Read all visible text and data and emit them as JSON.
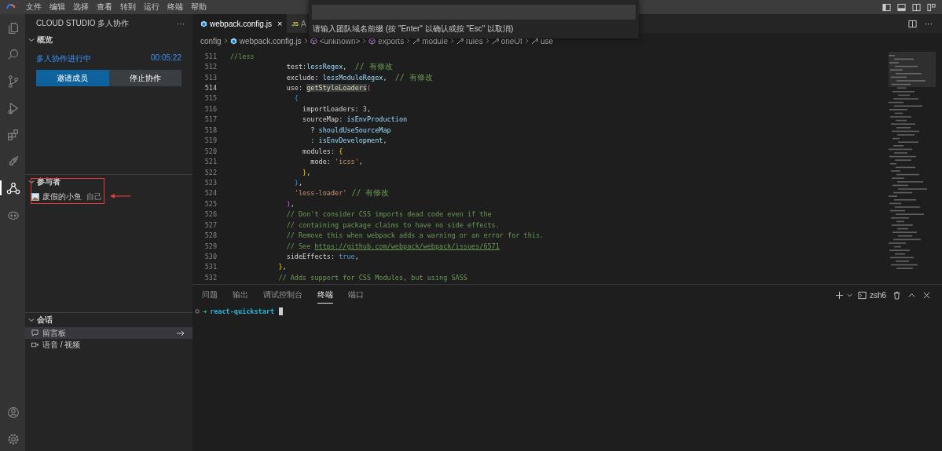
{
  "menu": {
    "items": [
      "文件",
      "编辑",
      "选择",
      "查看",
      "转到",
      "运行",
      "终端",
      "帮助"
    ]
  },
  "activity_bar": {
    "items": [
      {
        "selected": false
      },
      {
        "selected": false
      },
      {
        "selected": false
      },
      {
        "selected": false
      },
      {
        "selected": false
      },
      {
        "selected": false
      },
      {
        "selected": true
      },
      {
        "selected": false
      }
    ]
  },
  "sidebar": {
    "title": "CLOUD STUDIO 多人协作",
    "more": "···",
    "overview": {
      "title": "概览",
      "expanded": true,
      "status": "多人协作进行中",
      "timer": "00:05:22",
      "buttons": [
        {
          "label": "邀请成员",
          "primary": true
        },
        {
          "label": "停止协作",
          "primary": false
        }
      ]
    },
    "participants": {
      "title": "参与者",
      "expanded": true,
      "items": [
        {
          "name": "废假的小鱼",
          "tag": "自己",
          "annotated": true
        }
      ]
    },
    "sessions": {
      "title": "会话",
      "expanded": true,
      "items": [
        {
          "label": "留言板",
          "hovered": true
        },
        {
          "label": "语音 / 视频",
          "hovered": false
        }
      ]
    }
  },
  "quick_input": {
    "hint": "请输入团队域名前缀 (按 \"Enter\" 以确认或按 \"Esc\" 以取消)"
  },
  "tabs": [
    {
      "label": "webpack.config.js",
      "kind": "webpack",
      "close": "×",
      "selected": true
    },
    {
      "label": "A",
      "kind": "js",
      "badge": "JS",
      "selected": false
    }
  ],
  "editor_more": "···",
  "breadcrumb": [
    {
      "label": "config",
      "kind": "folder"
    },
    {
      "label": "webpack.config.js",
      "kind": "file"
    },
    {
      "label": "<unknown>",
      "kind": "module"
    },
    {
      "label": "exports",
      "kind": "module"
    },
    {
      "label": "module",
      "kind": "property"
    },
    {
      "label": "rules",
      "kind": "property"
    },
    {
      "label": "oneOf",
      "kind": "property"
    },
    {
      "label": "use",
      "kind": "property"
    }
  ],
  "code": [
    {
      "n": "511",
      "current": false,
      "tokens": [
        {
          "text": "//less",
          "kind": "comment"
        }
      ]
    },
    {
      "n": "512",
      "current": false,
      "tokens": [
        {
          "text": "              test:",
          "kind": "plain"
        },
        {
          "text": "lessRegex",
          "kind": "var"
        },
        {
          "text": ",  ",
          "kind": "plain"
        },
        {
          "text": "// 有修改",
          "kind": "comment"
        }
      ]
    },
    {
      "n": "513",
      "current": false,
      "tokens": [
        {
          "text": "              exclude: ",
          "kind": "plain"
        },
        {
          "text": "lessModuleRegex",
          "kind": "var"
        },
        {
          "text": ",  ",
          "kind": "plain"
        },
        {
          "text": "// 有修改",
          "kind": "comment"
        }
      ]
    },
    {
      "n": "514",
      "current": true,
      "tokens": [
        {
          "text": "              use: ",
          "kind": "plain"
        },
        {
          "text": "getStyleLoaders",
          "kind": "match"
        },
        {
          "text": "(",
          "kind": "bracket2"
        }
      ]
    },
    {
      "n": "515",
      "current": false,
      "tokens": [
        {
          "text": "                {",
          "kind": "bracket3"
        }
      ]
    },
    {
      "n": "516",
      "current": false,
      "tokens": [
        {
          "text": "                  importLoaders: ",
          "kind": "plain"
        },
        {
          "text": "3",
          "kind": "number"
        },
        {
          "text": ",",
          "kind": "plain"
        }
      ]
    },
    {
      "n": "517",
      "current": false,
      "tokens": [
        {
          "text": "                  sourceMap: ",
          "kind": "plain"
        },
        {
          "text": "isEnvProduction",
          "kind": "var"
        }
      ]
    },
    {
      "n": "518",
      "current": false,
      "tokens": [
        {
          "text": "                    ? ",
          "kind": "plain"
        },
        {
          "text": "shouldUseSourceMap",
          "kind": "var"
        }
      ]
    },
    {
      "n": "519",
      "current": false,
      "tokens": [
        {
          "text": "                    : ",
          "kind": "plain"
        },
        {
          "text": "isEnvDevelopment",
          "kind": "var"
        },
        {
          "text": ",",
          "kind": "plain"
        }
      ]
    },
    {
      "n": "520",
      "current": false,
      "tokens": [
        {
          "text": "                  modules: ",
          "kind": "plain"
        },
        {
          "text": "{",
          "kind": "bracket1"
        }
      ]
    },
    {
      "n": "521",
      "current": false,
      "tokens": [
        {
          "text": "                    mode: ",
          "kind": "plain"
        },
        {
          "text": "'icss'",
          "kind": "string"
        },
        {
          "text": ",",
          "kind": "plain"
        }
      ]
    },
    {
      "n": "522",
      "current": false,
      "tokens": [
        {
          "text": "                  }",
          "kind": "bracket1"
        },
        {
          "text": ",",
          "kind": "plain"
        }
      ]
    },
    {
      "n": "523",
      "current": false,
      "tokens": [
        {
          "text": "                }",
          "kind": "bracket3"
        },
        {
          "text": ",",
          "kind": "plain"
        }
      ]
    },
    {
      "n": "524",
      "current": false,
      "tokens": [
        {
          "text": "                'less-loader'",
          "kind": "string"
        },
        {
          "text": " // 有修改",
          "kind": "comment"
        }
      ]
    },
    {
      "n": "525",
      "current": false,
      "tokens": [
        {
          "text": "              )",
          "kind": "bracket2"
        },
        {
          "text": ",",
          "kind": "plain"
        }
      ]
    },
    {
      "n": "526",
      "current": false,
      "tokens": [
        {
          "text": "              // Don't consider CSS imports dead code even if the",
          "kind": "comment"
        }
      ]
    },
    {
      "n": "527",
      "current": false,
      "tokens": [
        {
          "text": "              // containing package claims to have no side effects.",
          "kind": "comment"
        }
      ]
    },
    {
      "n": "528",
      "current": false,
      "tokens": [
        {
          "text": "              // Remove this when webpack adds a warning or an error for this.",
          "kind": "comment"
        }
      ]
    },
    {
      "n": "529",
      "current": false,
      "tokens": [
        {
          "text": "              // See ",
          "kind": "comment"
        },
        {
          "text": "https://github.com/webpack/webpack/issues/6571",
          "kind": "link"
        }
      ]
    },
    {
      "n": "530",
      "current": false,
      "tokens": [
        {
          "text": "              sideEffects: ",
          "kind": "plain"
        },
        {
          "text": "true",
          "kind": "bool"
        },
        {
          "text": ",",
          "kind": "plain"
        }
      ]
    },
    {
      "n": "531",
      "current": false,
      "tokens": [
        {
          "text": "            }",
          "kind": "bracket1"
        },
        {
          "text": ",",
          "kind": "plain"
        }
      ]
    },
    {
      "n": "532",
      "current": false,
      "tokens": [
        {
          "text": "            // Adds support for CSS Modules, but using SASS",
          "kind": "comment"
        }
      ]
    }
  ],
  "panel": {
    "tabs": [
      {
        "label": "问题",
        "selected": false
      },
      {
        "label": "输出",
        "selected": false
      },
      {
        "label": "调试控制台",
        "selected": false
      },
      {
        "label": "终端",
        "selected": true
      },
      {
        "label": "端口",
        "selected": false
      }
    ],
    "shell": "zsh6",
    "prompt": "➜",
    "cwd": "react-quickstart"
  }
}
